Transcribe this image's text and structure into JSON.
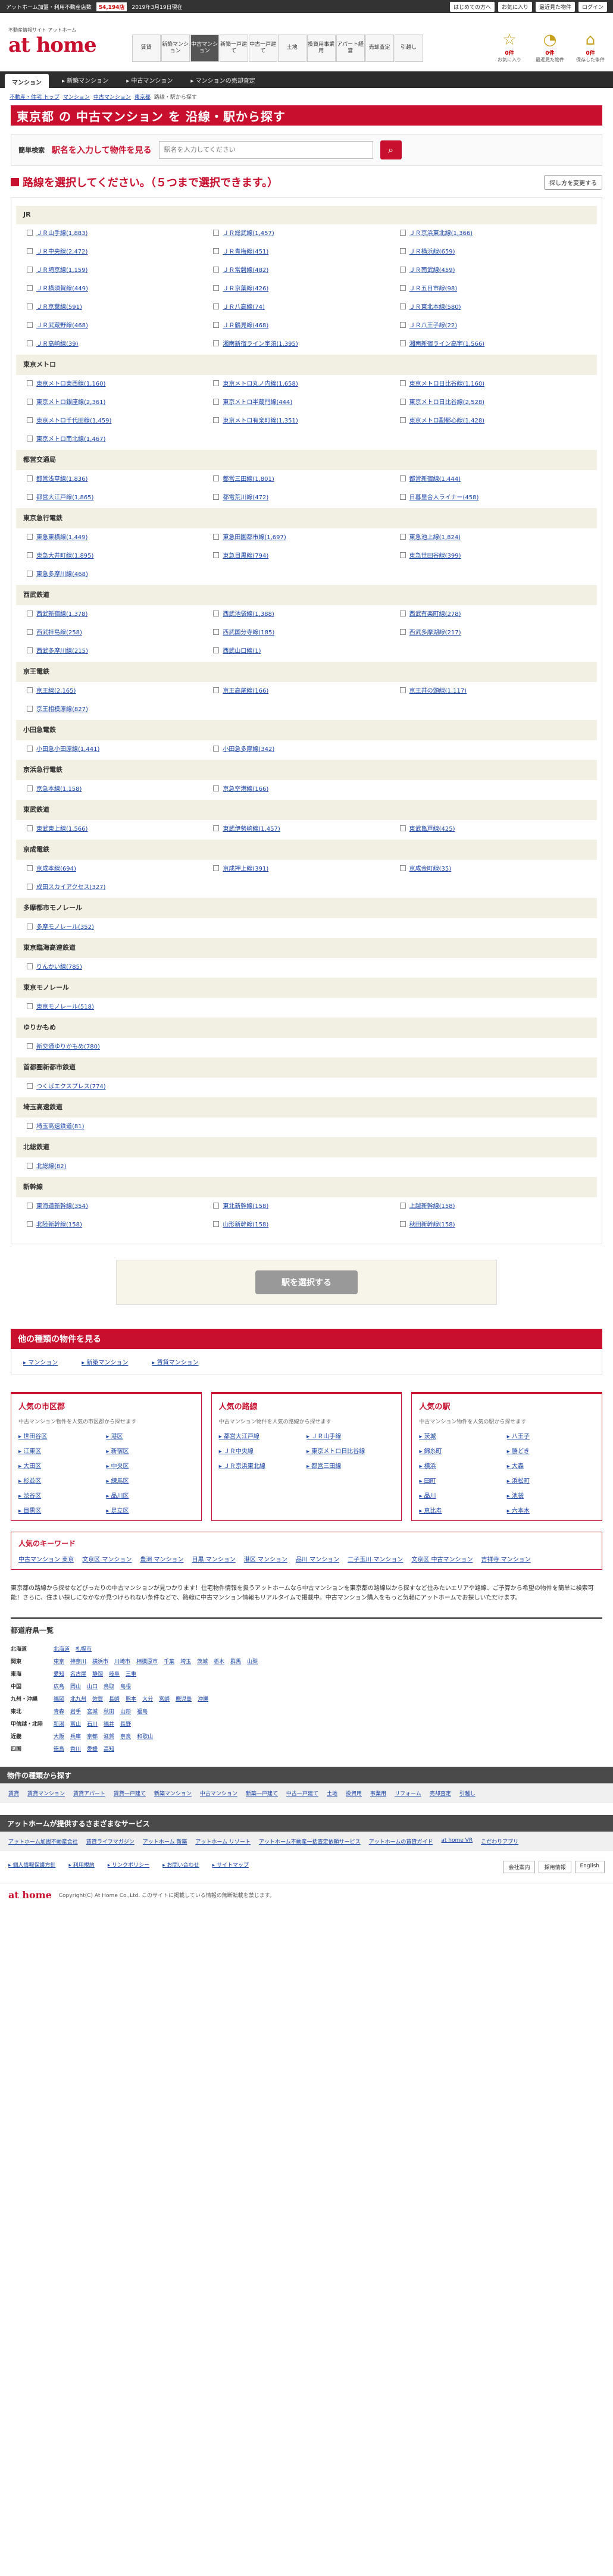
{
  "topbar": {
    "text1": "アットホーム加盟・利用不動産店数",
    "count": "54,194店",
    "date": "2019年3月19日現在",
    "right": [
      "はじめての方へ",
      "お気に入り",
      "最近見た物件",
      "ログイン"
    ]
  },
  "logo": {
    "sub": "不動産情報サイト アットホーム",
    "text": "at home"
  },
  "gnav": [
    "賃貸",
    "新築マンション",
    "中古マンション",
    "新築一戸建て",
    "中古一戸建て",
    "土地",
    "投資用事業用",
    "アパート経営",
    "売却査定",
    "引越し"
  ],
  "hicons": [
    {
      "icon": "☆",
      "count": "0件",
      "label": "お気に入り"
    },
    {
      "icon": "◔",
      "count": "0件",
      "label": "最近見た物件"
    },
    {
      "icon": "⌂",
      "count": "0件",
      "label": "保存した条件"
    }
  ],
  "tabbar": {
    "current": "マンション",
    "items": [
      "新築マンション",
      "中古マンション",
      "マンションの売却査定"
    ]
  },
  "breadcrumb": [
    "不動産・住宅 トップ",
    "マンション",
    "中古マンション",
    "東京都",
    "路線・駅から探す"
  ],
  "hero": "東京都 の 中古マンション を 沿線・駅から探す",
  "search": {
    "badge": "簡単検索",
    "label": "駅名を入力して物件を見る",
    "placeholder": "駅名を入力してください"
  },
  "page_title": "路線を選択してください。（５つまで選択できます。）",
  "sort": "探し方を変更する",
  "companies": [
    {
      "name": "JR",
      "lines": [
        "ＪＲ山手線(1,883)",
        "ＪＲ総武線(1,457)",
        "ＪＲ京浜東北線(1,366)",
        "ＪＲ中央線(2,472)",
        "ＪＲ青梅線(451)",
        "ＪＲ横浜線(659)",
        "ＪＲ埼京線(1,159)",
        "ＪＲ常磐線(482)",
        "ＪＲ南武線(459)",
        "ＪＲ横須賀線(449)",
        "ＪＲ京葉線(426)",
        "ＪＲ五日市線(98)",
        "ＪＲ京葉線(591)",
        "ＪＲ八高線(74)",
        "ＪＲ東北本線(580)",
        "ＪＲ武蔵野線(468)",
        "ＪＲ鶴見線(468)",
        "ＪＲ八王子線(22)",
        "ＪＲ高崎線(39)",
        "湘南新宿ライン宇須(1,395)",
        "湘南新宿ライン高宇(1,566)"
      ]
    },
    {
      "name": "東京メトロ",
      "lines": [
        "東京メトロ東西線(1,160)",
        "東京メトロ丸ノ内線(1,658)",
        "東京メトロ日比谷線(1,160)",
        "東京メトロ銀座線(2,361)",
        "東京メトロ半蔵門線(444)",
        "東京メトロ日比谷線(2,528)",
        "東京メトロ千代田線(1,459)",
        "東京メトロ有楽町線(1,351)",
        "東京メトロ副都心線(1,428)",
        "東京メトロ南北線(1,467)"
      ]
    },
    {
      "name": "都営交通局",
      "lines": [
        "都営浅草線(1,836)",
        "都営三田線(1,801)",
        "都営新宿線(1,444)",
        "都営大江戸線(1,865)",
        "都電荒川線(472)",
        "日暮里舎人ライナー(458)"
      ]
    },
    {
      "name": "東京急行電鉄",
      "lines": [
        "東急東横線(1,449)",
        "東急田園都市線(1,697)",
        "東急池上線(1,824)",
        "東急大井町線(1,895)",
        "東急目黒線(794)",
        "東急世田谷線(399)",
        "東急多摩川線(468)"
      ]
    },
    {
      "name": "西武鉄道",
      "lines": [
        "西武新宿線(1,378)",
        "西武池袋線(1,388)",
        "西武有楽町線(278)",
        "西武拝島線(258)",
        "西武国分寺線(185)",
        "西武多摩湖線(217)",
        "西武多摩川線(215)",
        "西武山口線(1)"
      ]
    },
    {
      "name": "京王電鉄",
      "lines": [
        "京王線(2,165)",
        "京王高尾線(166)",
        "京王井の頭線(1,117)",
        "京王相模原線(827)"
      ]
    },
    {
      "name": "小田急電鉄",
      "lines": [
        "小田急小田原線(1,441)",
        "小田急多摩線(342)"
      ]
    },
    {
      "name": "京浜急行電鉄",
      "lines": [
        "京急本線(1,158)",
        "京急空港線(166)"
      ]
    },
    {
      "name": "東武鉄道",
      "lines": [
        "東武東上線(1,566)",
        "東武伊勢崎線(1,457)",
        "東武亀戸線(425)"
      ]
    },
    {
      "name": "京成電鉄",
      "lines": [
        "京成本線(694)",
        "京成押上線(391)",
        "京成金町線(35)",
        "成田スカイアクセス(327)"
      ]
    },
    {
      "name": "多摩都市モノレール",
      "lines": [
        "多摩モノレール(352)"
      ]
    },
    {
      "name": "東京臨海高速鉄道",
      "lines": [
        "りんかい線(785)"
      ]
    },
    {
      "name": "東京モノレール",
      "lines": [
        "東京モノレール(518)"
      ]
    },
    {
      "name": "ゆりかもめ",
      "lines": [
        "新交通ゆりかもめ(780)"
      ]
    },
    {
      "name": "首都圏新都市鉄道",
      "lines": [
        "つくばエクスプレス(774)"
      ]
    },
    {
      "name": "埼玉高速鉄道",
      "lines": [
        "埼玉高速鉄道(81)"
      ]
    },
    {
      "name": "北総鉄道",
      "lines": [
        "北総線(82)"
      ]
    },
    {
      "name": "新幹線",
      "lines": [
        "東海道新幹線(354)",
        "東北新幹線(158)",
        "上越新幹線(158)",
        "北陸新幹線(158)",
        "山形新幹線(158)",
        "秋田新幹線(158)"
      ]
    }
  ],
  "select_button": "駅を選択する",
  "other": {
    "title": "他の種類の物件を見る",
    "links": [
      "マンション",
      "新築マンション",
      "賃貸マンション"
    ]
  },
  "popular": [
    {
      "title": "人気の市区郡",
      "desc": "中古マンション物件を人気の市区郡から探せます",
      "items": [
        "世田谷区",
        "港区",
        "江東区",
        "新宿区",
        "大田区",
        "中央区",
        "杉並区",
        "練馬区",
        "渋谷区",
        "品川区",
        "目黒区",
        "足立区"
      ]
    },
    {
      "title": "人気の路線",
      "desc": "中古マンション物件を人気の路線から探せます",
      "items": [
        "都営大江戸線",
        "ＪＲ山手線",
        "ＪＲ中央線",
        "東京メトロ日比谷線",
        "ＪＲ京浜東北線",
        "都営三田線"
      ]
    },
    {
      "title": "人気の駅",
      "desc": "中古マンション物件を人気の駅から探せます",
      "items": [
        "茨城",
        "八王子",
        "錦糸町",
        "勝どき",
        "横浜",
        "大森",
        "田町",
        "浜松町",
        "品川",
        "池袋",
        "恵比寿",
        "六本木"
      ]
    }
  ],
  "keywords": {
    "title": "人気のキーワード",
    "items": [
      "中古マンション 東京",
      "文京区 マンション",
      "豊洲 マンション",
      "目黒 マンション",
      "港区 マンション",
      "品川 マンション",
      "二子玉川 マンション",
      "文京区 中古マンション",
      "吉祥寺 マンション"
    ]
  },
  "description": "東京都の路線から探せなどびったりの中古マンションが見つかります！住宅物件情報を扱うアットホームなら中古マンションを東京都の路線以から探すなど住みたいエリアや路線、ご予算から希望の物件を簡単に検索可能！さらに、住まい探しになかなか見つけられない条件などで、路線に中古マンション情報もリアルタイムで掲載中。中古マンション購入をもっと気軽にアットホームでお探しいただけます。",
  "prefectures": {
    "title": "都道府県一覧",
    "rows": [
      {
        "region": "北海道",
        "prefs": [
          "北海道",
          "札幌市"
        ]
      },
      {
        "region": "関東",
        "prefs": [
          "東京",
          "神奈川",
          "横浜市",
          "川崎市",
          "相模原市",
          "千葉",
          "埼玉",
          "茨城",
          "栃木",
          "群馬",
          "山梨"
        ]
      },
      {
        "region": "東海",
        "prefs": [
          "愛知",
          "名古屋",
          "静岡",
          "岐阜",
          "三重"
        ]
      },
      {
        "region": "中国",
        "prefs": [
          "広島",
          "岡山",
          "山口",
          "鳥取",
          "島根"
        ]
      },
      {
        "region": "九州・沖縄",
        "prefs": [
          "福岡",
          "北九州",
          "佐賀",
          "長崎",
          "熊本",
          "大分",
          "宮崎",
          "鹿児島",
          "沖縄"
        ]
      },
      {
        "region": "東北",
        "prefs": [
          "青森",
          "岩手",
          "宮城",
          "秋田",
          "山形",
          "福島"
        ]
      },
      {
        "region": "甲信越・北陸",
        "prefs": [
          "新潟",
          "富山",
          "石川",
          "福井",
          "長野"
        ]
      },
      {
        "region": "近畿",
        "prefs": [
          "大阪",
          "兵庫",
          "京都",
          "滋賀",
          "奈良",
          "和歌山"
        ]
      },
      {
        "region": "四国",
        "prefs": [
          "徳島",
          "香川",
          "愛媛",
          "高知"
        ]
      }
    ]
  },
  "kinds": {
    "title": "物件の種類から探す",
    "items": [
      "賃貸",
      "賃貸マンション",
      "賃貸アパート",
      "賃貸一戸建て",
      "新築マンション",
      "中古マンション",
      "新築一戸建て",
      "中古一戸建て",
      "土地",
      "投資用",
      "事業用",
      "リフォーム",
      "売却査定",
      "引越し"
    ]
  },
  "services": {
    "title": "アットホームが提供するさまざまなサービス",
    "items": [
      "アットホーム加盟不動産会社",
      "賃貸ライフマガジン",
      "アットホーム 新築",
      "アットホーム リゾート",
      "アットホーム不動産一括査定依頼サービス",
      "アットホームの賃貸ガイド",
      "at home VR",
      "こだわりアプリ"
    ]
  },
  "footer": {
    "links": [
      "個人情報保護方針",
      "利用規約",
      "リンクポリシー",
      "お問い合わせ",
      "サイトマップ"
    ],
    "right": [
      "会社案内",
      "採用情報",
      "English"
    ],
    "copyright": "Copyright(C) At Home Co.,Ltd. このサイトに掲載している情報の無断転載を禁じます。"
  }
}
